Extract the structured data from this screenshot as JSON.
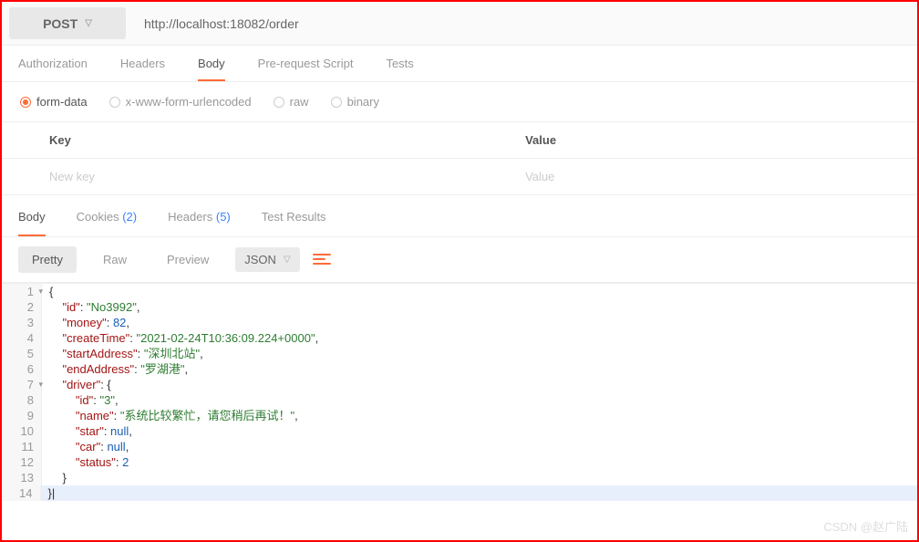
{
  "request": {
    "method": "POST",
    "url": "http://localhost:18082/order",
    "tabs": [
      "Authorization",
      "Headers",
      "Body",
      "Pre-request Script",
      "Tests"
    ],
    "active_tab": "Body",
    "body_types": [
      {
        "label": "form-data",
        "selected": true
      },
      {
        "label": "x-www-form-urlencoded",
        "selected": false
      },
      {
        "label": "raw",
        "selected": false
      },
      {
        "label": "binary",
        "selected": false
      }
    ],
    "kv": {
      "key_header": "Key",
      "value_header": "Value",
      "key_placeholder": "New key",
      "value_placeholder": "Value"
    }
  },
  "response": {
    "tabs": [
      {
        "label": "Body",
        "count": null,
        "active": true
      },
      {
        "label": "Cookies",
        "count": "(2)",
        "active": false
      },
      {
        "label": "Headers",
        "count": "(5)",
        "active": false
      },
      {
        "label": "Test Results",
        "count": null,
        "active": false
      }
    ],
    "views": {
      "pretty": "Pretty",
      "raw": "Raw",
      "preview": "Preview"
    },
    "type_label": "JSON",
    "json_lines": [
      {
        "n": 1,
        "fold": true,
        "t": [
          {
            "c": "pun",
            "v": "{"
          }
        ]
      },
      {
        "n": 2,
        "t": [
          {
            "c": "pun",
            "v": "    "
          },
          {
            "c": "key",
            "v": "\"id\""
          },
          {
            "c": "pun",
            "v": ": "
          },
          {
            "c": "str",
            "v": "\"No3992\""
          },
          {
            "c": "pun",
            "v": ","
          }
        ]
      },
      {
        "n": 3,
        "t": [
          {
            "c": "pun",
            "v": "    "
          },
          {
            "c": "key",
            "v": "\"money\""
          },
          {
            "c": "pun",
            "v": ": "
          },
          {
            "c": "num",
            "v": "82"
          },
          {
            "c": "pun",
            "v": ","
          }
        ]
      },
      {
        "n": 4,
        "t": [
          {
            "c": "pun",
            "v": "    "
          },
          {
            "c": "key",
            "v": "\"createTime\""
          },
          {
            "c": "pun",
            "v": ": "
          },
          {
            "c": "str",
            "v": "\"2021-02-24T10:36:09.224+0000\""
          },
          {
            "c": "pun",
            "v": ","
          }
        ]
      },
      {
        "n": 5,
        "t": [
          {
            "c": "pun",
            "v": "    "
          },
          {
            "c": "key",
            "v": "\"startAddress\""
          },
          {
            "c": "pun",
            "v": ": "
          },
          {
            "c": "str",
            "v": "\"深圳北站\""
          },
          {
            "c": "pun",
            "v": ","
          }
        ]
      },
      {
        "n": 6,
        "t": [
          {
            "c": "pun",
            "v": "    "
          },
          {
            "c": "key",
            "v": "\"endAddress\""
          },
          {
            "c": "pun",
            "v": ": "
          },
          {
            "c": "str",
            "v": "\"罗湖港\""
          },
          {
            "c": "pun",
            "v": ","
          }
        ]
      },
      {
        "n": 7,
        "fold": true,
        "t": [
          {
            "c": "pun",
            "v": "    "
          },
          {
            "c": "key",
            "v": "\"driver\""
          },
          {
            "c": "pun",
            "v": ": {"
          }
        ]
      },
      {
        "n": 8,
        "t": [
          {
            "c": "pun",
            "v": "        "
          },
          {
            "c": "key",
            "v": "\"id\""
          },
          {
            "c": "pun",
            "v": ": "
          },
          {
            "c": "str",
            "v": "\"3\""
          },
          {
            "c": "pun",
            "v": ","
          }
        ]
      },
      {
        "n": 9,
        "t": [
          {
            "c": "pun",
            "v": "        "
          },
          {
            "c": "key",
            "v": "\"name\""
          },
          {
            "c": "pun",
            "v": ": "
          },
          {
            "c": "str",
            "v": "\"系统比较繁忙，请您稍后再试！\""
          },
          {
            "c": "pun",
            "v": ","
          }
        ]
      },
      {
        "n": 10,
        "t": [
          {
            "c": "pun",
            "v": "        "
          },
          {
            "c": "key",
            "v": "\"star\""
          },
          {
            "c": "pun",
            "v": ": "
          },
          {
            "c": "nul",
            "v": "null"
          },
          {
            "c": "pun",
            "v": ","
          }
        ]
      },
      {
        "n": 11,
        "t": [
          {
            "c": "pun",
            "v": "        "
          },
          {
            "c": "key",
            "v": "\"car\""
          },
          {
            "c": "pun",
            "v": ": "
          },
          {
            "c": "nul",
            "v": "null"
          },
          {
            "c": "pun",
            "v": ","
          }
        ]
      },
      {
        "n": 12,
        "t": [
          {
            "c": "pun",
            "v": "        "
          },
          {
            "c": "key",
            "v": "\"status\""
          },
          {
            "c": "pun",
            "v": ": "
          },
          {
            "c": "num",
            "v": "2"
          }
        ]
      },
      {
        "n": 13,
        "t": [
          {
            "c": "pun",
            "v": "    }"
          }
        ]
      },
      {
        "n": 14,
        "cursor": true,
        "t": [
          {
            "c": "pun",
            "v": "}"
          }
        ]
      }
    ]
  },
  "watermark": "CSDN @赵广陆"
}
